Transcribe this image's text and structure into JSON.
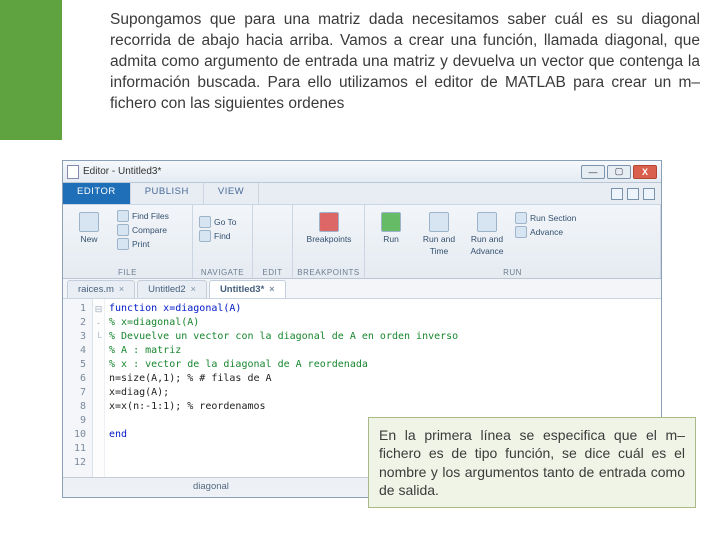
{
  "intro": "Supongamos que para una matriz dada necesitamos saber cuál es su diagonal recorrida de abajo hacia arriba. Vamos a crear una función, llamada diagonal, que admita como argumento de entrada una matriz y devuelva un vector que contenga la información buscada. Para ello utilizamos el editor de MATLAB para crear un m–fichero con las siguientes ordenes",
  "window": {
    "title": "Editor - Untitled3*"
  },
  "wincontrols": {
    "min": "—",
    "max": "▢",
    "close": "X"
  },
  "ribbon_tabs": {
    "editor": "EDITOR",
    "publish": "PUBLISH",
    "view": "VIEW"
  },
  "groups": {
    "file": {
      "label": "FILE",
      "new": "New",
      "find": "Find Files",
      "compare": "Compare",
      "print": "Print"
    },
    "navigate": {
      "label": "NAVIGATE",
      "goto": "Go To",
      "find": "Find"
    },
    "edit": {
      "label": "EDIT"
    },
    "breakpoints": {
      "label": "BREAKPOINTS",
      "btn": "Breakpoints"
    },
    "run": {
      "label": "RUN",
      "run": "Run",
      "runand": "Run and",
      "time": "Time",
      "advance": "Advance",
      "runsection": "Run Section",
      "adv": "Advance"
    }
  },
  "doctabs": {
    "raices": "raices.m",
    "u2": "Untitled2",
    "u3": "Untitled3*"
  },
  "code": {
    "l1": "function x=diagonal(A)",
    "l2": "% x=diagonal(A)",
    "l3": "% Devuelve un vector con la diagonal de A en orden inverso",
    "l4": "% A : matriz",
    "l5": "% x : vector de la diagonal de A reordenada",
    "l6": "n=size(A,1); % # filas de A",
    "l7": "x=diag(A);",
    "l8": "x=x(n:-1:1); % reordenamos",
    "l9": "",
    "l10": "end"
  },
  "lines": [
    "1",
    "2",
    "3",
    "4",
    "5",
    "6",
    "7",
    "8",
    "9",
    "10",
    "11",
    "12"
  ],
  "status": {
    "fn": "diagonal"
  },
  "callout": "En la primera línea se especifica que el m–fichero es de tipo función, se dice cuál es el nombre y los argumentos tanto de entrada como de salida."
}
